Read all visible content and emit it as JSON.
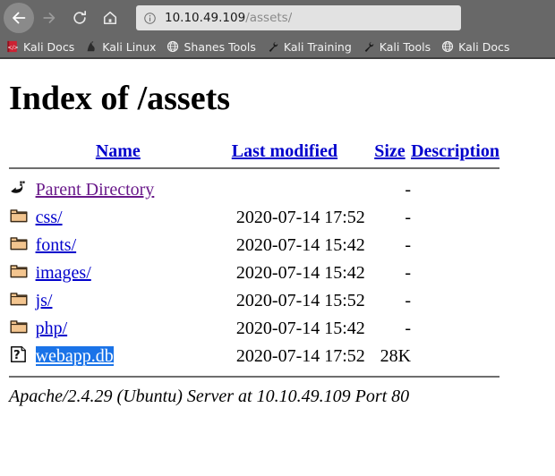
{
  "browser": {
    "nav": {
      "back_label": "Back",
      "forward_label": "Forward",
      "reload_label": "Reload",
      "home_label": "Home"
    },
    "url": {
      "host": "10.10.49.109",
      "path": "/assets/",
      "info_icon": "info-circle-icon"
    },
    "bookmarks": [
      {
        "label": "Kali Docs",
        "icon": "kali-docs-book-icon"
      },
      {
        "label": "Kali Linux",
        "icon": "kali-dragon-icon"
      },
      {
        "label": "Shanes Tools",
        "icon": "globe-icon"
      },
      {
        "label": "Kali Training",
        "icon": "wrench-icon"
      },
      {
        "label": "Kali Tools",
        "icon": "wrench-icon"
      },
      {
        "label": "Kali Docs",
        "icon": "globe-icon"
      }
    ]
  },
  "page": {
    "title": "Index of /assets",
    "columns": {
      "name": "Name",
      "last_modified": "Last modified",
      "size": "Size",
      "description": "Description"
    },
    "entries": [
      {
        "name": "Parent Directory",
        "icon": "back-arrow-icon",
        "link_type": "parent",
        "last_modified": "",
        "size": "-",
        "description": ""
      },
      {
        "name": "css/",
        "icon": "folder-icon",
        "link_type": "dir",
        "last_modified": "2020-07-14 17:52",
        "size": "-",
        "description": ""
      },
      {
        "name": "fonts/",
        "icon": "folder-icon",
        "link_type": "dir",
        "last_modified": "2020-07-14 15:42",
        "size": "-",
        "description": ""
      },
      {
        "name": "images/",
        "icon": "folder-icon",
        "link_type": "dir",
        "last_modified": "2020-07-14 15:42",
        "size": "-",
        "description": ""
      },
      {
        "name": "js/",
        "icon": "folder-icon",
        "link_type": "dir",
        "last_modified": "2020-07-14 15:52",
        "size": "-",
        "description": ""
      },
      {
        "name": "php/",
        "icon": "folder-icon",
        "link_type": "dir",
        "last_modified": "2020-07-14 15:42",
        "size": "-",
        "description": ""
      },
      {
        "name": "webapp.db",
        "icon": "unknown-file-icon",
        "link_type": "selected",
        "last_modified": "2020-07-14 17:52",
        "size": "28K",
        "description": ""
      }
    ],
    "footer": "Apache/2.4.29 (Ubuntu) Server at 10.10.49.109 Port 80"
  },
  "colors": {
    "chrome_bg": "#686868",
    "link_blue": "#0000cc",
    "link_visited_purple": "#6a1a8a",
    "selection_blue": "#1a73e8",
    "folder_tan": "#f0c080",
    "rule_gray": "#6e6e6e"
  }
}
